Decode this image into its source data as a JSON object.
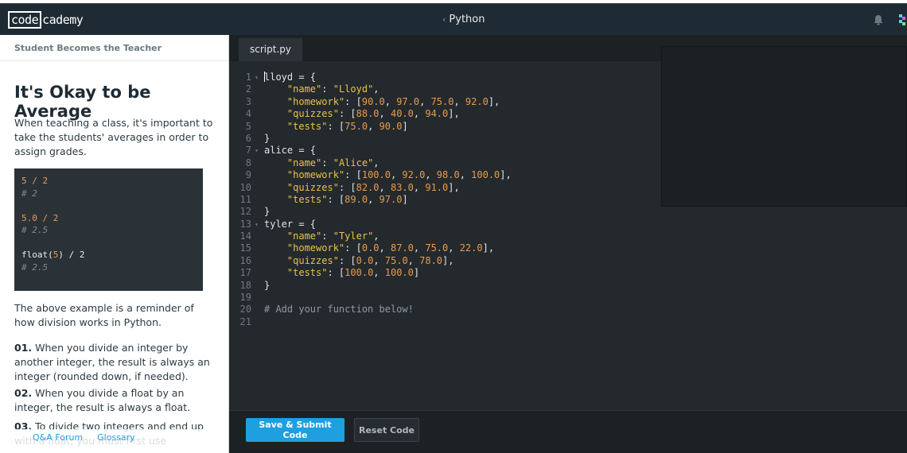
{
  "header": {
    "logo_boxed": "code",
    "logo_rest": "cademy",
    "breadcrumb": "Python",
    "icons": [
      "bell-icon",
      "avatar-icon"
    ]
  },
  "lesson": {
    "section": "Student Becomes the Teacher",
    "title": "It's Okay to be Average",
    "intro": "When teaching a class, it's important to take the students' averages in order to assign grades.",
    "example_lines": [
      {
        "code": "5 / 2",
        "type": "code"
      },
      {
        "code": "# 2",
        "type": "comment"
      },
      {
        "code": "",
        "type": "blank"
      },
      {
        "code": "5.0 / 2",
        "type": "code"
      },
      {
        "code": "# 2.5",
        "type": "comment"
      },
      {
        "code": "",
        "type": "blank"
      },
      {
        "code": "float(5) / 2",
        "type": "code"
      },
      {
        "code": "# 2.5",
        "type": "comment"
      }
    ],
    "reminder": "The above example is a reminder of how division works in Python.",
    "point1_num": "01.",
    "point1": " When you divide an integer by another integer, the result is always an integer (rounded down, if needed).",
    "point2_num": "02.",
    "point2": " When you divide a float by an integer, the result is always a float.",
    "point3_num": "03.",
    "point3": " To divide two integers and end up with a float, you must first use",
    "footer_links": [
      "Q&A Forum",
      "Glossary"
    ]
  },
  "editor": {
    "tab": "script.py",
    "lines": [
      "lloyd = {",
      "    \"name\": \"Lloyd\",",
      "    \"homework\": [90.0, 97.0, 75.0, 92.0],",
      "    \"quizzes\": [88.0, 40.0, 94.0],",
      "    \"tests\": [75.0, 90.0]",
      "}",
      "alice = {",
      "    \"name\": \"Alice\",",
      "    \"homework\": [100.0, 92.0, 98.0, 100.0],",
      "    \"quizzes\": [82.0, 83.0, 91.0],",
      "    \"tests\": [89.0, 97.0]",
      "}",
      "tyler = {",
      "    \"name\": \"Tyler\",",
      "    \"homework\": [0.0, 87.0, 75.0, 22.0],",
      "    \"quizzes\": [0.0, 75.0, 78.0],",
      "    \"tests\": [100.0, 100.0]",
      "}",
      "",
      "# Add your function below!",
      ""
    ],
    "fold_lines": [
      1,
      7,
      13
    ],
    "submit_label": "Save & Submit Code",
    "reset_label": "Reset Code"
  }
}
